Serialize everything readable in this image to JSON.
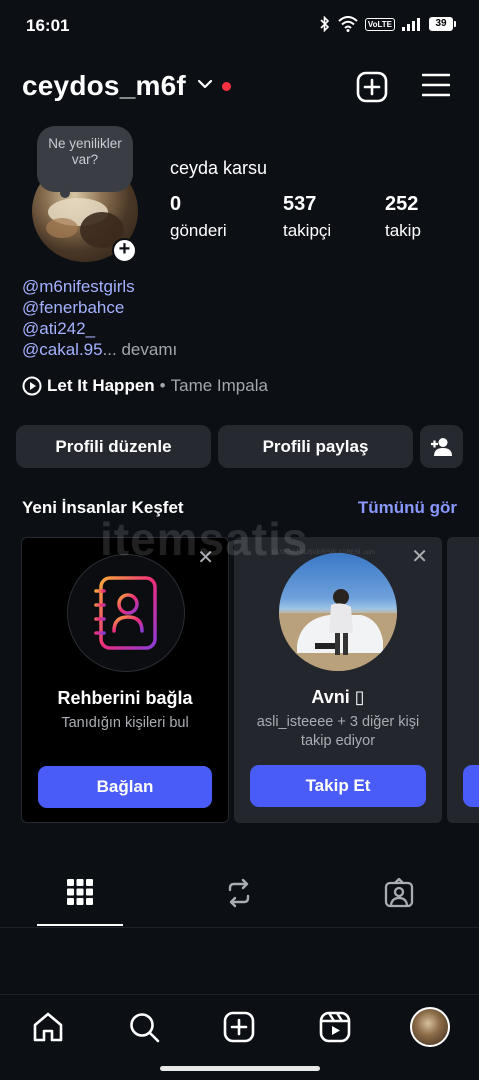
{
  "status": {
    "time": "16:01",
    "volte": "VoLTE",
    "battery": "39"
  },
  "header": {
    "username": "ceydos_m6f"
  },
  "profile": {
    "note": "Ne yenilikler var?",
    "full_name": "ceyda karsu",
    "stats": [
      {
        "value": "0",
        "label": "gönderi"
      },
      {
        "value": "537",
        "label": "takipçi"
      },
      {
        "value": "252",
        "label": "takip"
      }
    ],
    "bio_links": [
      "@m6nifestgirls",
      "@fenerbahce",
      "@ati242_"
    ],
    "bio_last_link": "@cakal.95",
    "bio_more": "... devamı",
    "music_song": "Let It Happen",
    "music_sep": "•",
    "music_artist": "Tame Impala"
  },
  "buttons": {
    "edit": "Profili düzenle",
    "share": "Profili paylaş"
  },
  "discover": {
    "title": "Yeni İnsanlar Keşfet",
    "see_all": "Tümünü gör",
    "cards": [
      {
        "title": "Rehberini bağla",
        "subtitle": "Tanıdığın kişileri bul",
        "button": "Bağlan"
      },
      {
        "title": "Avni ▯",
        "subtitle": "asli_isteeee + 3 diğer kişi takip ediyor",
        "button": "Takip Et"
      }
    ]
  },
  "watermark": {
    "text": "itemsatis",
    "sub": "GÜVENLİ ALIŞVERİŞİN ADRESİ   .com"
  },
  "colors": {
    "accent": "#4a5cf8",
    "link": "#a4b1ff",
    "background": "#0c0f14",
    "button_bg": "#262a30",
    "red_dot": "#ff3040"
  }
}
